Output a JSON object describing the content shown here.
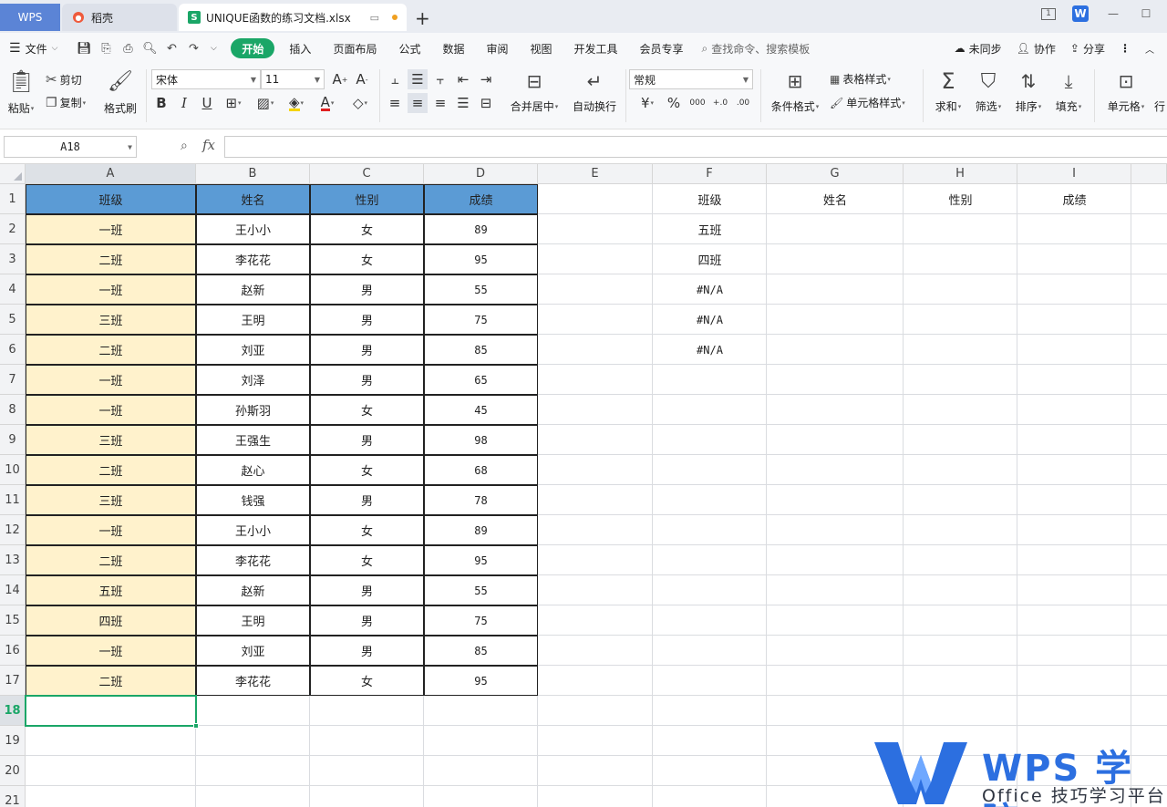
{
  "titlebar": {
    "wps_tab": "WPS",
    "daoke_tab": "稻壳",
    "doc_tab": "UNIQUE函数的练习文档.xlsx",
    "new_tab": "+",
    "page_indicator": "1"
  },
  "menubar": {
    "file": "文件",
    "tabs": [
      "开始",
      "插入",
      "页面布局",
      "公式",
      "数据",
      "审阅",
      "视图",
      "开发工具",
      "会员专享"
    ],
    "search": "查找命令、搜索模板",
    "sync": "未同步",
    "collab": "协作",
    "share": "分享"
  },
  "ribbon": {
    "paste": "粘贴",
    "cut": "剪切",
    "copy": "复制",
    "format_painter": "格式刷",
    "font_name": "宋体",
    "font_size": "11",
    "merge_center": "合并居中",
    "auto_wrap": "自动换行",
    "number_format": "常规",
    "currency": "¥",
    "percent": "%",
    "thousands": "000",
    "inc_decimal": "+.0",
    "dec_decimal": ".00",
    "cond_format": "条件格式",
    "table_style": "表格样式",
    "cell_style": "单元格样式",
    "sum": "求和",
    "filter": "筛选",
    "sort": "排序",
    "fill": "填充",
    "cell": "单元格",
    "row_col": "行"
  },
  "formulabar": {
    "name_box": "A18",
    "fx": "fx",
    "formula": ""
  },
  "columns": [
    "A",
    "B",
    "C",
    "D",
    "E",
    "F",
    "G",
    "H",
    "I"
  ],
  "rows": [
    "1",
    "2",
    "3",
    "4",
    "5",
    "6",
    "7",
    "8",
    "9",
    "10",
    "11",
    "12",
    "13",
    "14",
    "15",
    "16",
    "17",
    "18",
    "19",
    "20",
    "21"
  ],
  "table": {
    "headers": [
      "班级",
      "姓名",
      "性别",
      "成绩"
    ],
    "rows": [
      [
        "一班",
        "王小小",
        "女",
        "89"
      ],
      [
        "二班",
        "李花花",
        "女",
        "95"
      ],
      [
        "一班",
        "赵新",
        "男",
        "55"
      ],
      [
        "三班",
        "王明",
        "男",
        "75"
      ],
      [
        "二班",
        "刘亚",
        "男",
        "85"
      ],
      [
        "一班",
        "刘泽",
        "男",
        "65"
      ],
      [
        "一班",
        "孙斯羽",
        "女",
        "45"
      ],
      [
        "三班",
        "王强生",
        "男",
        "98"
      ],
      [
        "二班",
        "赵心",
        "女",
        "68"
      ],
      [
        "三班",
        "钱强",
        "男",
        "78"
      ],
      [
        "一班",
        "王小小",
        "女",
        "89"
      ],
      [
        "二班",
        "李花花",
        "女",
        "95"
      ],
      [
        "五班",
        "赵新",
        "男",
        "55"
      ],
      [
        "四班",
        "王明",
        "男",
        "75"
      ],
      [
        "一班",
        "刘亚",
        "男",
        "85"
      ],
      [
        "二班",
        "李花花",
        "女",
        "95"
      ]
    ]
  },
  "result": {
    "headers": [
      "班级",
      "姓名",
      "性别",
      "成绩"
    ],
    "class_values": [
      "五班",
      "四班",
      "#N/A",
      "#N/A",
      "#N/A"
    ]
  },
  "watermark": {
    "title": "WPS 学院",
    "subtitle": "Office 技巧学习平台"
  },
  "colors": {
    "accent": "#1aa667",
    "header_fill": "#5b9bd5",
    "class_fill": "#fff2cc",
    "watermark_blue": "#2c6fe0"
  }
}
